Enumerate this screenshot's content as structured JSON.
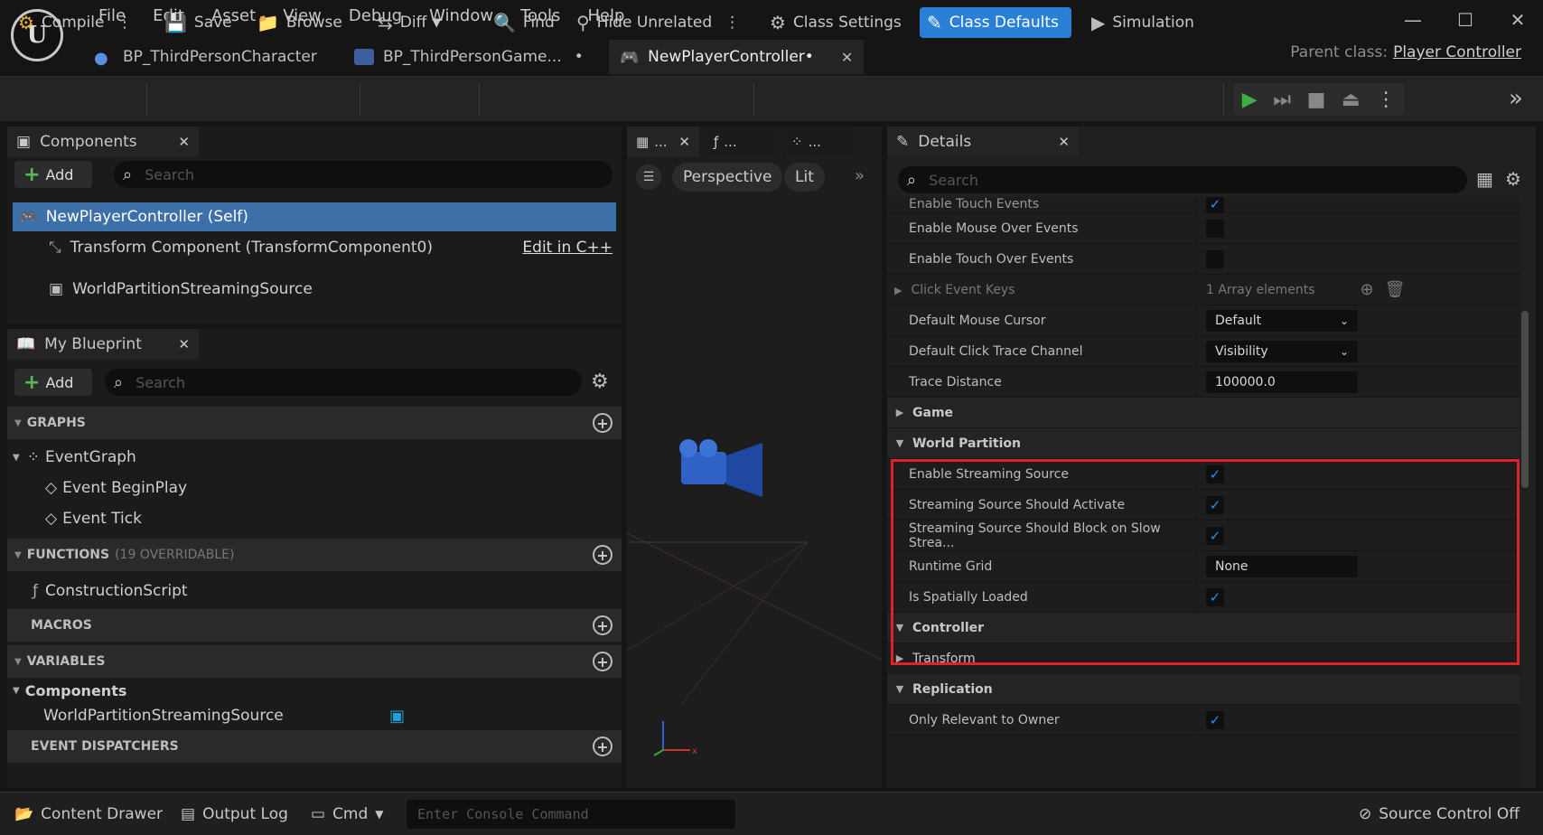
{
  "app": {
    "logo": "U"
  },
  "menu": [
    "File",
    "Edit",
    "Asset",
    "View",
    "Debug",
    "Window",
    "Tools",
    "Help"
  ],
  "window_controls": [
    "—",
    "☐",
    "✕"
  ],
  "tabs": [
    {
      "label": "BP_ThirdPersonCharacter",
      "modified": ""
    },
    {
      "label": "BP_ThirdPersonGame...",
      "modified": "•"
    },
    {
      "label": "NewPlayerController•",
      "close": "✕"
    }
  ],
  "parent_class": {
    "label": "Parent class:",
    "value": "Player Controller"
  },
  "toolbar": {
    "compile": "Compile",
    "save": "Save",
    "browse": "Browse",
    "diff": "Diff",
    "find": "Find",
    "hide_unrelated": "Hide Unrelated",
    "class_settings": "Class Settings",
    "class_defaults": "Class Defaults",
    "simulation": "Simulation"
  },
  "components": {
    "tab": "Components",
    "add": "Add",
    "search_placeholder": "Search",
    "self": "NewPlayerController (Self)",
    "transform": "Transform Component (TransformComponent0)",
    "edit_cpp": "Edit in C++",
    "wpss": "WorldPartitionStreamingSource"
  },
  "my_blueprint": {
    "tab": "My Blueprint",
    "add": "Add",
    "search_placeholder": "Search",
    "graphs": "GRAPHS",
    "event_graph": "EventGraph",
    "begin_play": "Event BeginPlay",
    "tick": "Event Tick",
    "functions": "FUNCTIONS",
    "functions_note": "(19 OVERRIDABLE)",
    "construction": "ConstructionScript",
    "macros": "MACROS",
    "variables": "VARIABLES",
    "components": "Components",
    "var_wpss": "WorldPartitionStreamingSource",
    "dispatchers": "EVENT DISPATCHERS"
  },
  "viewport": {
    "tab1": "...",
    "tab2": "...",
    "tab3": "...",
    "perspective": "Perspective",
    "lit": "Lit"
  },
  "details": {
    "tab": "Details",
    "search_placeholder": "Search",
    "rows_top": [
      {
        "label": "Enable Touch Events",
        "type": "check",
        "checked": true
      },
      {
        "label": "Enable Mouse Over Events",
        "type": "check",
        "checked": false
      },
      {
        "label": "Enable Touch Over Events",
        "type": "check",
        "checked": false
      },
      {
        "label": "Click Event Keys",
        "type": "array",
        "value": "1 Array elements"
      },
      {
        "label": "Default Mouse Cursor",
        "type": "dropdown",
        "value": "Default"
      },
      {
        "label": "Default Click Trace Channel",
        "type": "dropdown",
        "value": "Visibility"
      },
      {
        "label": "Trace Distance",
        "type": "number",
        "value": "100000.0"
      }
    ],
    "game": "Game",
    "world_partition": "World Partition",
    "wp_rows": [
      {
        "label": "Enable Streaming Source",
        "type": "check",
        "checked": true
      },
      {
        "label": "Streaming Source Should Activate",
        "type": "check",
        "checked": true
      },
      {
        "label": "Streaming Source Should Block on Slow Strea...",
        "type": "check",
        "checked": true
      },
      {
        "label": "Runtime Grid",
        "type": "text",
        "value": "None"
      },
      {
        "label": "Is Spatially Loaded",
        "type": "check",
        "checked": true
      }
    ],
    "controller": "Controller",
    "transform": "Transform",
    "replication": "Replication",
    "only_relevant": "Only Relevant to Owner"
  },
  "bottom": {
    "content_drawer": "Content Drawer",
    "output_log": "Output Log",
    "cmd": "Cmd",
    "console_placeholder": "Enter Console Command",
    "source_control": "Source Control Off"
  },
  "colors": {
    "accent": "#2a7fd6",
    "highlight": "#e0202a",
    "play": "#3cb043"
  }
}
